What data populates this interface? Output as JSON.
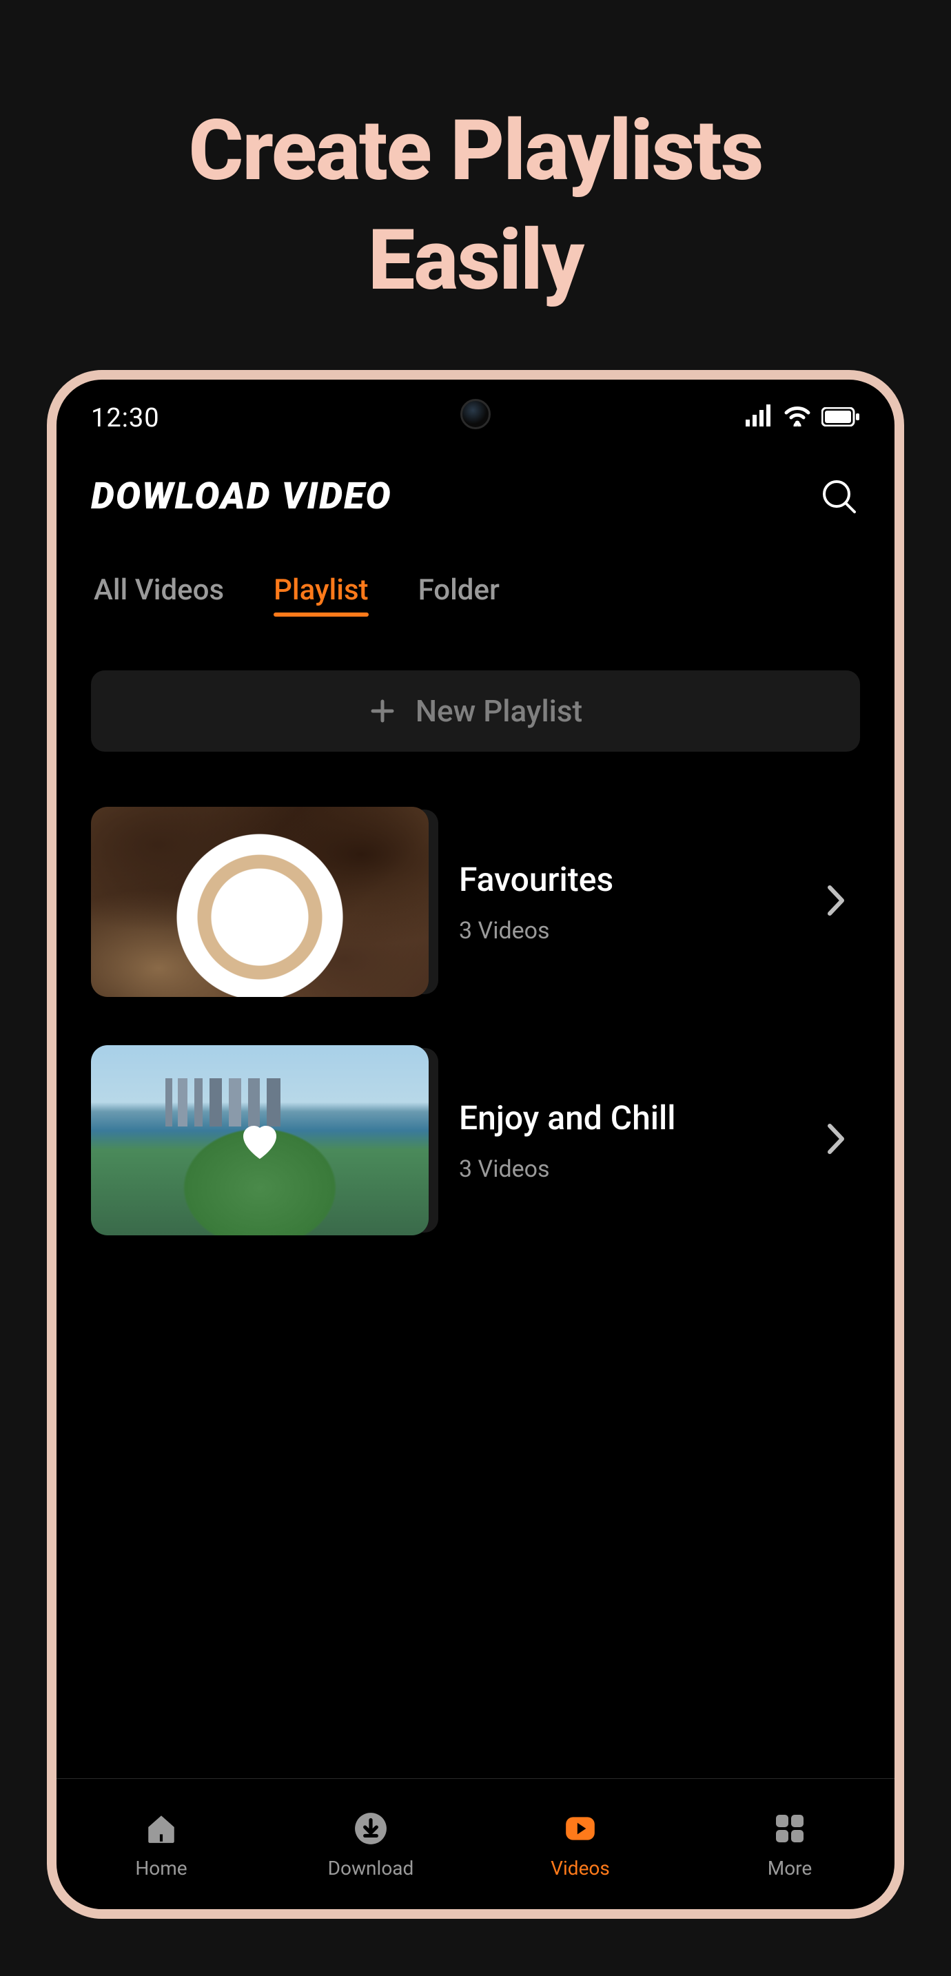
{
  "promo": {
    "title_line1": "Create Playlists",
    "title_line2": "Easily"
  },
  "status_bar": {
    "time": "12:30"
  },
  "header": {
    "title": "DOWLOAD VIDEO"
  },
  "tabs": [
    {
      "label": "All Videos",
      "active": false
    },
    {
      "label": "Playlist",
      "active": true
    },
    {
      "label": "Folder",
      "active": false
    }
  ],
  "actions": {
    "new_playlist": "New Playlist"
  },
  "playlists": [
    {
      "title": "Favourites",
      "meta": "3 Videos",
      "thumb": "coffee"
    },
    {
      "title": "Enjoy and Chill",
      "meta": "3 Videos",
      "thumb": "city"
    }
  ],
  "bottom_nav": [
    {
      "label": "Home",
      "icon": "home",
      "active": false
    },
    {
      "label": "Download",
      "icon": "download",
      "active": false
    },
    {
      "label": "Videos",
      "icon": "video",
      "active": true
    },
    {
      "label": "More",
      "icon": "grid",
      "active": false
    }
  ],
  "colors": {
    "accent": "#ff7a1a",
    "promo_text": "#f6c9b9"
  }
}
